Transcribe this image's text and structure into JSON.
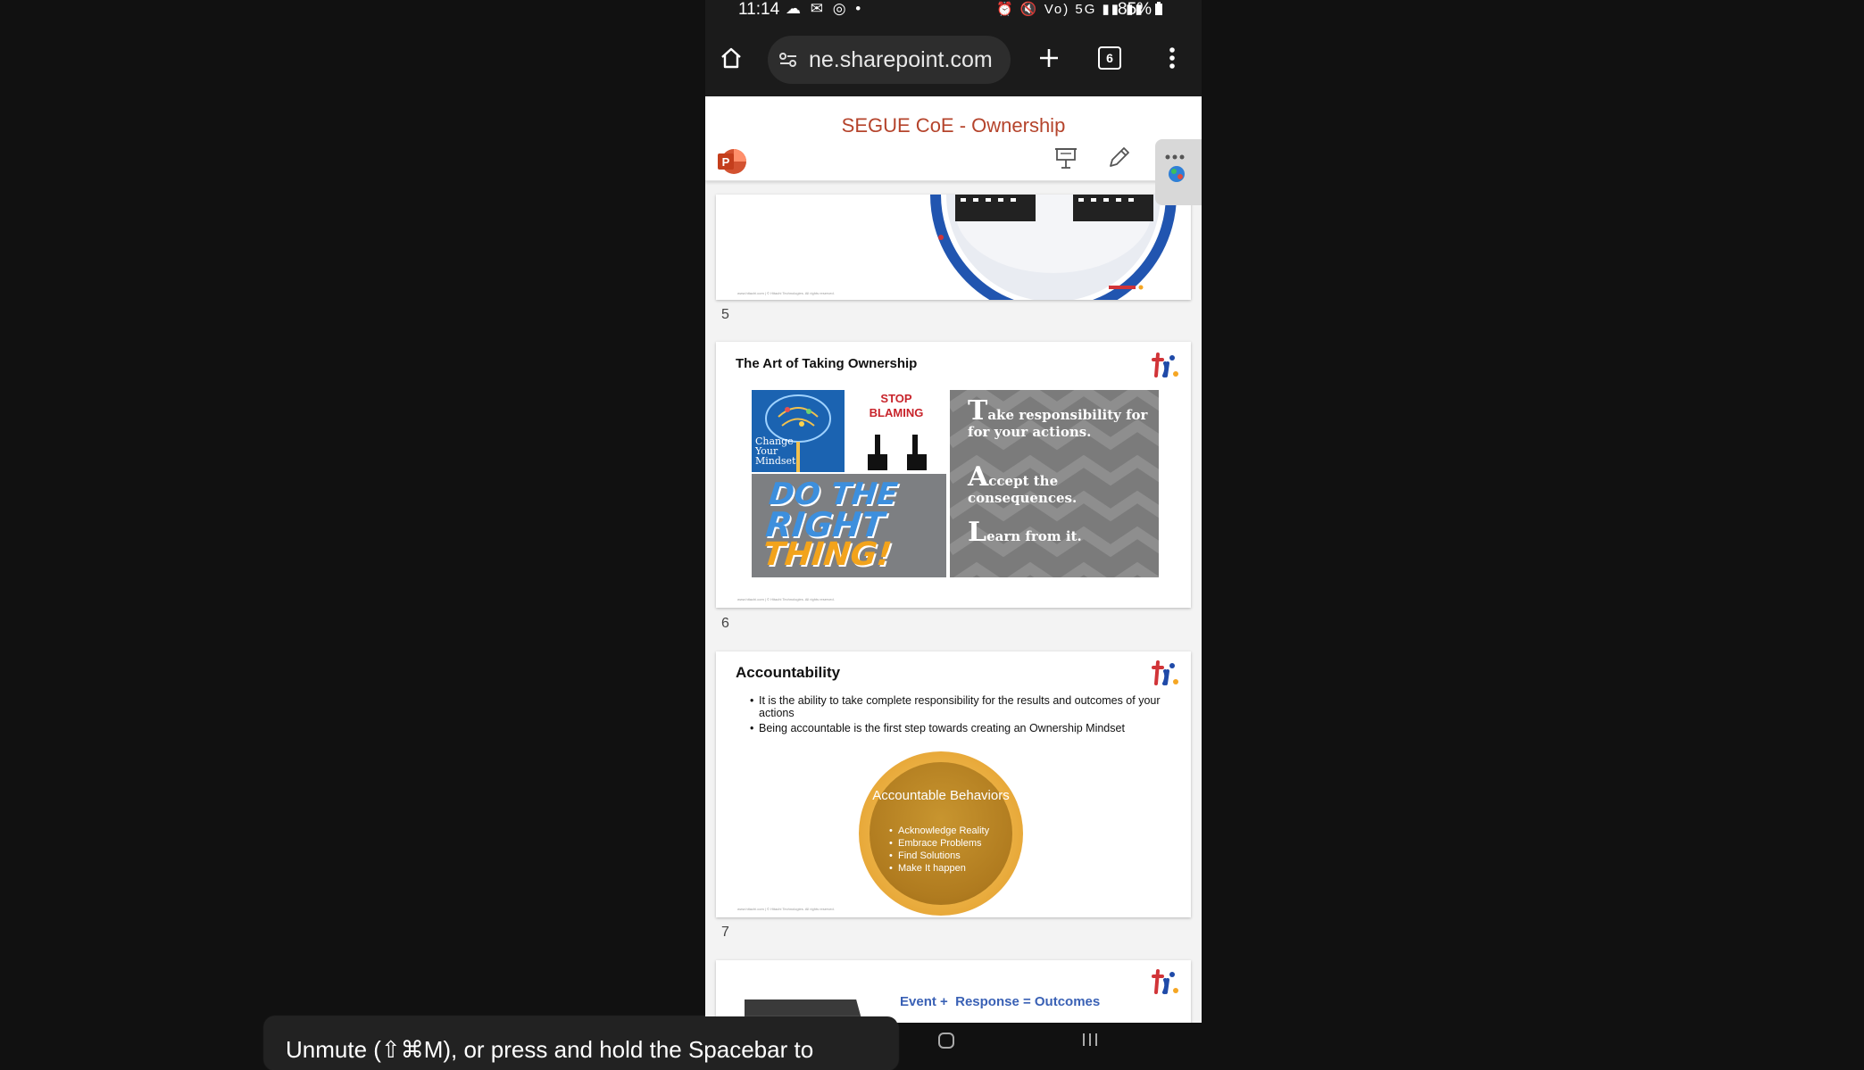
{
  "status_bar": {
    "time": "11:14",
    "left_icons": "☁ ✉ ◎ •",
    "right_icons": "⏰ 🔇 Vo) 5G ▮▮ ▮▮",
    "battery": "85%"
  },
  "browser": {
    "url": "ne.sharepoint.com",
    "tab_count": "6"
  },
  "document": {
    "title": "SEGUE CoE - Ownership",
    "app_logo_letter": "P"
  },
  "slides": {
    "s5": {
      "number": "5",
      "footer": "www.hitachi.com  |  © Hitachi Technologies. All rights reserved."
    },
    "s6": {
      "number": "6",
      "title": "The Art of Taking Ownership",
      "brain_text": "Change Your Mindset",
      "stop_line1": "STOP",
      "stop_line2": "BLAMING",
      "do_line1": "DO THE",
      "do_line2": "RIGHT",
      "do_line3": "THING!",
      "tal1_cap": "T",
      "tal1_rest": "ake responsibility for for your actions.",
      "tal2_cap": "A",
      "tal2_rest": "ccept the consequences.",
      "tal3_cap": "L",
      "tal3_rest": "earn from it.",
      "footer": "www.hitachi.com  |  © Hitachi Technologies. All rights reserved."
    },
    "s7": {
      "number": "7",
      "title": "Accountability",
      "bullets": [
        "It is the ability to take complete responsibility for the results and outcomes of your actions",
        "Being accountable is the first step towards creating an Ownership Mindset"
      ],
      "circle_title": "Accountable Behaviors",
      "circle_items": [
        "Acknowledge Reality",
        "Embrace Problems",
        "Find Solutions",
        "Make It happen"
      ],
      "footer": "www.hitachi.com  |  © Hitachi Technologies. All rights reserved."
    },
    "s8": {
      "equation": "Event +  Response = Outcomes"
    }
  },
  "tooltip": {
    "text": "Unmute (⇧⌘M), or press and hold the Spacebar to"
  },
  "colors": {
    "title_red": "#b5442c",
    "logo_red": "#d13438",
    "logo_blue": "#1f4aa8",
    "equation_blue": "#3a61b5"
  }
}
